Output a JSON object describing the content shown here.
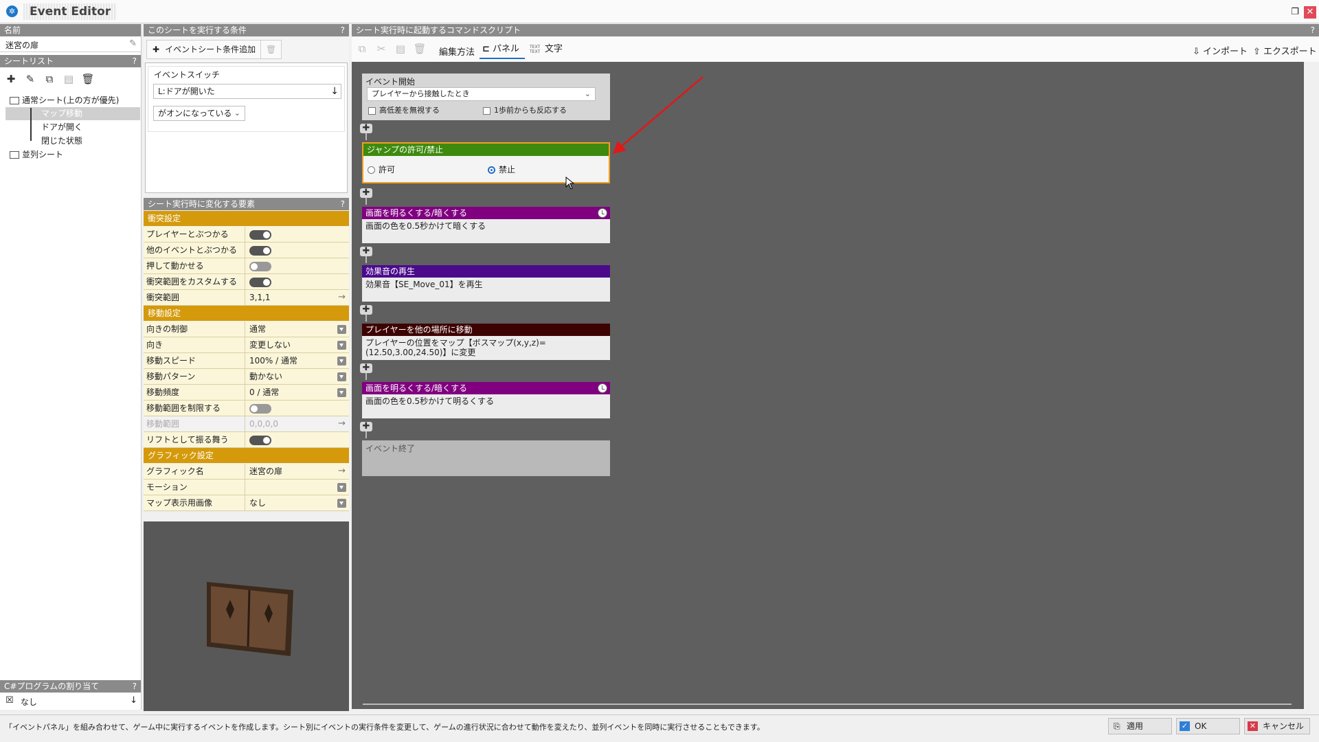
{
  "app": {
    "title": "Event Editor"
  },
  "left": {
    "name_header": "名前",
    "name_value": "迷宮の扉",
    "sheetlist_header": "シートリスト",
    "help": "?",
    "tree": [
      {
        "label": "通常シート(上の方が優先)"
      },
      {
        "label": "マップ移動"
      },
      {
        "label": "ドアが開く"
      },
      {
        "label": "閉じた状態"
      },
      {
        "label": "並列シート"
      }
    ],
    "csharp_header": "C#プログラムの割り当て",
    "csharp_value": "なし"
  },
  "conditions": {
    "header": "このシートを実行する条件",
    "add_button": "イベントシート条件追加",
    "switch_label": "イベントスイッチ",
    "switch_value": "L:ドアが開いた",
    "state_value": "がオンになっている"
  },
  "props": {
    "header": "シート実行時に変化する要素",
    "sections": {
      "collision": "衝突設定",
      "movement": "移動設定",
      "graphic": "グラフィック設定"
    },
    "rows": [
      {
        "label": "プレイヤーとぶつかる",
        "type": "toggle",
        "on": true
      },
      {
        "label": "他のイベントとぶつかる",
        "type": "toggle",
        "on": true
      },
      {
        "label": "押して動かせる",
        "type": "toggle",
        "on": false
      },
      {
        "label": "衝突範囲をカスタムする",
        "type": "toggle",
        "on": true
      },
      {
        "label": "衝突範囲",
        "value": "3,1,1"
      },
      {
        "label": "向きの制御",
        "value": "通常"
      },
      {
        "label": "向き",
        "value": "変更しない"
      },
      {
        "label": "移動スピード",
        "value": "100% / 通常"
      },
      {
        "label": "移動パターン",
        "value": "動かない"
      },
      {
        "label": "移動頻度",
        "value": "0 / 通常"
      },
      {
        "label": "移動範囲を制限する",
        "type": "toggle",
        "on": false
      },
      {
        "label": "移動範囲",
        "value": "0,0,0,0"
      },
      {
        "label": "リフトとして振る舞う",
        "type": "toggle",
        "on": true
      },
      {
        "label": "グラフィック名",
        "value": "迷宮の扉"
      },
      {
        "label": "モーション",
        "value": ""
      },
      {
        "label": "マップ表示用画像",
        "value": "なし"
      }
    ]
  },
  "script": {
    "header": "シート実行時に起動するコマンドスクリプト",
    "edit_method": "編集方法",
    "mode_panel": "パネル",
    "mode_text": "文字",
    "text_icon_glyph": "TEXT",
    "import": "インポート",
    "export": "エクスポート",
    "event_start": {
      "title": "イベント開始",
      "trigger": "プレイヤーから接触したとき",
      "ignore_height": "高低差を無視する",
      "one_step": "1歩前からも反応する"
    },
    "panels": [
      {
        "title": "ジャンプの許可/禁止",
        "color": "#3e8a0e",
        "allow": "許可",
        "deny": "禁止"
      },
      {
        "title": "画面を明るくする/暗くする",
        "color": "#800080",
        "body": "画面の色を0.5秒かけて暗くする"
      },
      {
        "title": "効果音の再生",
        "color": "#4b0a8c",
        "body": "効果音【SE_Move_01】を再生"
      },
      {
        "title": "プレイヤーを他の場所に移動",
        "color": "#3d0303",
        "body": "プレイヤーの位置をマップ【ボスマップ(x,y,z)=(12.50,3.00,24.50)】に変更"
      },
      {
        "title": "画面を明るくする/暗くする",
        "color": "#800080",
        "body": "画面の色を0.5秒かけて明るくする"
      }
    ],
    "event_end": "イベント終了"
  },
  "status": {
    "message": "「イベントパネル」を組み合わせて、ゲーム中に実行するイベントを作成します。シート別にイベントの実行条件を変更して、ゲームの進行状況に合わせて動作を変えたり、並列イベントを同時に実行させることもできます。",
    "apply": "適用",
    "ok": "OK",
    "cancel": "キャンセル"
  }
}
